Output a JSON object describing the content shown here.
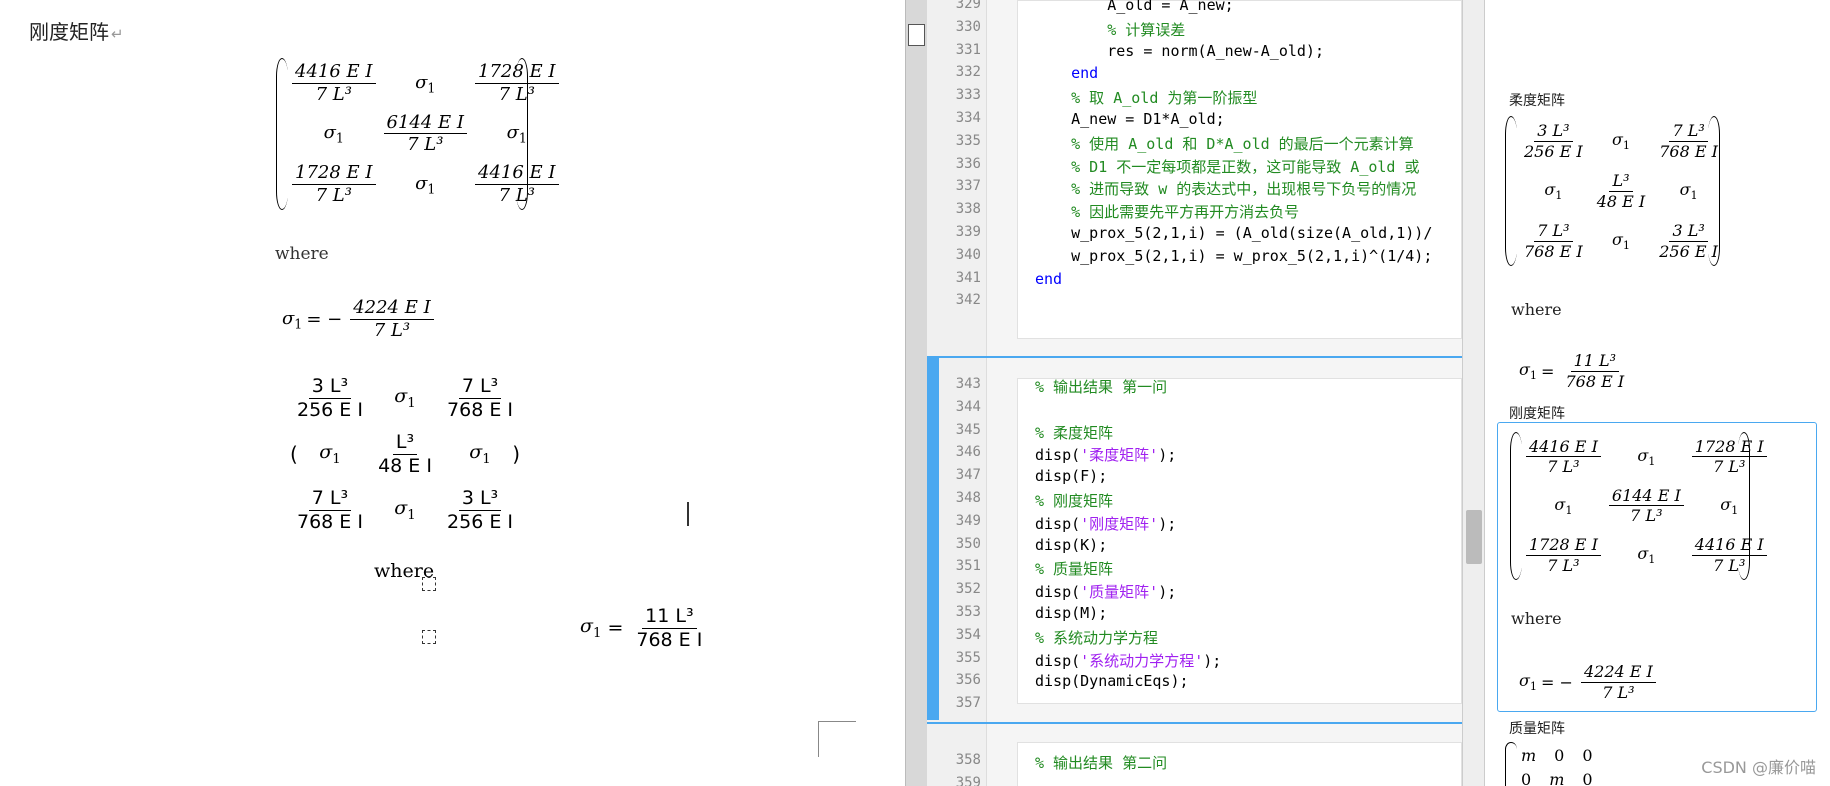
{
  "word": {
    "heading": "刚度矩阵",
    "para_mark": "↵",
    "matrix1": [
      [
        "4416 E I",
        "7 L³"
      ],
      [
        "σ",
        "1"
      ],
      [
        "1728 E I",
        "7 L³"
      ],
      [
        "σ",
        "1"
      ],
      [
        "6144 E I",
        "7 L³"
      ],
      [
        "σ",
        "1"
      ],
      [
        "1728 E I",
        "7 L³"
      ],
      [
        "σ",
        "1"
      ],
      [
        "4416 E I",
        "7 L³"
      ]
    ],
    "where1": "where",
    "sigma_eq1": {
      "lhs": "σ",
      "sub": "1",
      "eq": "= −",
      "num": "4224 E I",
      "den": "7 L³"
    },
    "matrix2": [
      [
        "3 L³",
        "256 E I"
      ],
      [
        "σ",
        "1"
      ],
      [
        "7 L³",
        "768 E I"
      ],
      [
        "σ",
        "1"
      ],
      [
        "L³",
        "48 E I"
      ],
      [
        "σ",
        "1"
      ],
      [
        "7 L³",
        "768 E I"
      ],
      [
        "σ",
        "1"
      ],
      [
        "3 L³",
        "256 E I"
      ]
    ],
    "where2": "where",
    "sigma_eq2": {
      "lhs": "σ",
      "sub": "1",
      "eq": "=",
      "num": "11 L³",
      "den": "768 E I"
    }
  },
  "editor": {
    "section1": {
      "lines": [
        {
          "n": "329",
          "code": "        A_old = A_new;"
        },
        {
          "n": "330",
          "code": "        % 计算误差"
        },
        {
          "n": "331",
          "code": "        res = norm(A_new-A_old);"
        },
        {
          "n": "332",
          "code": "    end"
        },
        {
          "n": "333",
          "code": "    % 取 A_old 为第一阶振型"
        },
        {
          "n": "334",
          "code": "    A_new = D1*A_old;"
        },
        {
          "n": "335",
          "code": "    % 使用 A_old 和 D*A_old 的最后一个元素计算"
        },
        {
          "n": "336",
          "code": "    % D1 不一定每项都是正数，这可能导致 A_old 或"
        },
        {
          "n": "337",
          "code": "    % 进而导致 w 的表达式中，出现根号下负号的情况"
        },
        {
          "n": "338",
          "code": "    % 因此需要先平方再开方消去负号"
        },
        {
          "n": "339",
          "code": "    w_prox_5(2,1,i) = (A_old(size(A_old,1))/"
        },
        {
          "n": "340",
          "code": "    w_prox_5(2,1,i) = w_prox_5(2,1,i)^(1/4);"
        },
        {
          "n": "341",
          "code": "end"
        },
        {
          "n": "342",
          "code": ""
        }
      ]
    },
    "section2": {
      "lines": [
        {
          "n": "343",
          "code": "% 输出结果 第一问"
        },
        {
          "n": "344",
          "code": ""
        },
        {
          "n": "345",
          "code": "% 柔度矩阵"
        },
        {
          "n": "346",
          "code": "disp('柔度矩阵');"
        },
        {
          "n": "347",
          "code": "disp(F);"
        },
        {
          "n": "348",
          "code": "% 刚度矩阵"
        },
        {
          "n": "349",
          "code": "disp('刚度矩阵');"
        },
        {
          "n": "350",
          "code": "disp(K);"
        },
        {
          "n": "351",
          "code": "% 质量矩阵"
        },
        {
          "n": "352",
          "code": "disp('质量矩阵');"
        },
        {
          "n": "353",
          "code": "disp(M);"
        },
        {
          "n": "354",
          "code": "% 系统动力学方程"
        },
        {
          "n": "355",
          "code": "disp('系统动力学方程');"
        },
        {
          "n": "356",
          "code": "disp(DynamicEqs);"
        },
        {
          "n": "357",
          "code": ""
        }
      ]
    },
    "section3": {
      "lines": [
        {
          "n": "358",
          "code": "% 输出结果 第二问"
        },
        {
          "n": "359",
          "code": ""
        }
      ]
    }
  },
  "output": {
    "label_flex": "柔度矩阵",
    "matrix_flex": [
      [
        "3 L³",
        "256 E I"
      ],
      [
        "σ",
        "1"
      ],
      [
        "7 L³",
        "768 E I"
      ],
      [
        "σ",
        "1"
      ],
      [
        "L³",
        "48 E I"
      ],
      [
        "σ",
        "1"
      ],
      [
        "7 L³",
        "768 E I"
      ],
      [
        "σ",
        "1"
      ],
      [
        "3 L³",
        "256 E I"
      ]
    ],
    "where1": "where",
    "sigma_flex": {
      "lhs": "σ",
      "sub": "1",
      "eq": "=",
      "num": "11 L³",
      "den": "768 E I"
    },
    "label_stiff": "刚度矩阵",
    "matrix_stiff": [
      [
        "4416 E I",
        "7 L³"
      ],
      [
        "σ",
        "1"
      ],
      [
        "1728 E I",
        "7 L³"
      ],
      [
        "σ",
        "1"
      ],
      [
        "6144 E I",
        "7 L³"
      ],
      [
        "σ",
        "1"
      ],
      [
        "1728 E I",
        "7 L³"
      ],
      [
        "σ",
        "1"
      ],
      [
        "4416 E I",
        "7 L³"
      ]
    ],
    "where2": "where",
    "sigma_stiff": {
      "lhs": "σ",
      "sub": "1",
      "eq": "= −",
      "num": "4224 E I",
      "den": "7 L³"
    },
    "label_mass": "质量矩阵",
    "mass_row1": [
      "m",
      "0",
      "0"
    ],
    "mass_row2": [
      "0",
      "m",
      "0"
    ]
  },
  "watermark": "CSDN @廉价喵"
}
